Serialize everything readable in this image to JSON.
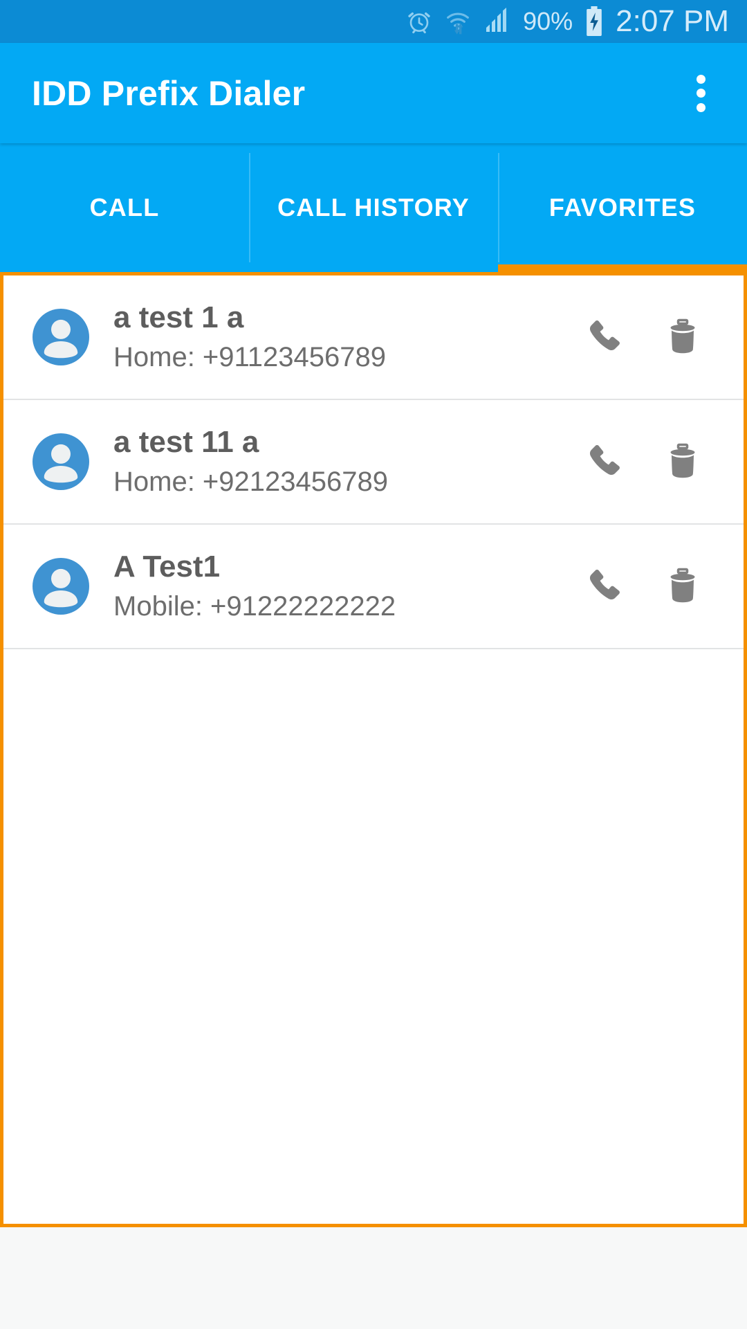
{
  "status_bar": {
    "alarm_icon": "alarm-clock-icon",
    "wifi_icon": "wifi-transfer-icon",
    "signal_icon": "cellular-signal-icon",
    "battery_percent": "90%",
    "battery_icon": "battery-charging-icon",
    "clock": "2:07 PM",
    "background_color": "#0c8bd4",
    "text_color": "#cfe9f8"
  },
  "app_bar": {
    "title": "IDD Prefix Dialer",
    "overflow_icon": "more-vertical-icon",
    "background_color": "#03a9f4",
    "title_color": "#ffffff"
  },
  "tabs": {
    "items": [
      {
        "label": "CALL",
        "active": false
      },
      {
        "label": "CALL HISTORY",
        "active": false
      },
      {
        "label": "FAVORITES",
        "active": true
      }
    ],
    "active_index": 2,
    "indicator_color": "#f59000",
    "background_color": "#03a9f4"
  },
  "content": {
    "border_color": "#f59000",
    "background_color": "#ffffff",
    "contacts": [
      {
        "avatar_icon": "person-avatar-icon",
        "name": "a test 1 a",
        "number": "Home: +91123456789",
        "call_icon": "phone-icon",
        "delete_icon": "trash-icon"
      },
      {
        "avatar_icon": "person-avatar-icon",
        "name": "a test 11 a",
        "number": "Home: +92123456789",
        "call_icon": "phone-icon",
        "delete_icon": "trash-icon"
      },
      {
        "avatar_icon": "person-avatar-icon",
        "name": "A Test1",
        "number": "Mobile: +91222222222",
        "call_icon": "phone-icon",
        "delete_icon": "trash-icon"
      }
    ]
  },
  "colors": {
    "accent_orange": "#f59000",
    "primary_blue": "#03a9f4",
    "status_blue": "#0c8bd4",
    "avatar_blue": "#3f93d2",
    "icon_gray": "#808080",
    "text_gray": "#5d5d5d"
  }
}
